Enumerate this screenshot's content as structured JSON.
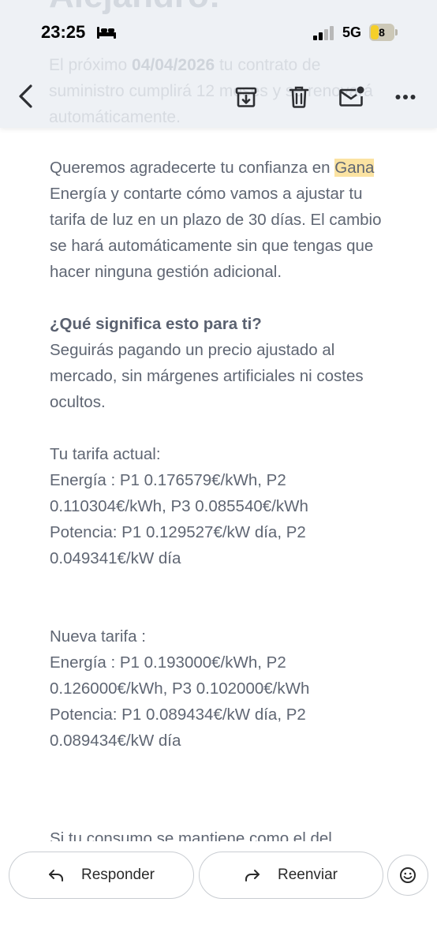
{
  "status_bar": {
    "time": "23:25",
    "network": "5G",
    "battery_level": "8",
    "icons": [
      "bed-icon",
      "signal-icon",
      "battery-icon"
    ],
    "battery_accent": "#f5cf29"
  },
  "faded_background": {
    "heading": "Alejandro!",
    "text_parts": [
      "El próximo ",
      "04/04/2026",
      " tu contrato de suministro cumplirá 12 meses y se renovará automáticamente."
    ]
  },
  "toolbar": {
    "icons": [
      "back-arrow-icon",
      "archive-icon",
      "trash-icon",
      "mail-unread-icon",
      "more-icon"
    ]
  },
  "email": {
    "intro_pre": "Queremos agradecerte tu confianza en ",
    "intro_highlight": "Gana",
    "intro_post": " Energía y contarte cómo vamos a ajustar tu tarifa de luz en un plazo de 30 días. El cambio se hará automáticamente sin que tengas que hacer ninguna gestión adicional.",
    "question": "¿Qué significa esto para ti?",
    "answer": "Seguirás pagando un precio ajustado al mercado, sin márgenes artificiales ni costes ocultos.",
    "current_title": "Tu tarifa actual:",
    "current_energy": "Energía : P1 0.176579€/kWh, P2 0.110304€/kWh, P3 0.085540€/kWh",
    "current_power": "Potencia: P1 0.129527€/kW día, P2 0.049341€/kW día",
    "new_title": "Nueva tarifa :",
    "new_energy": "Energía : P1 0.193000€/kWh, P2 0.126000€/kWh, P3 0.102000€/kWh",
    "new_power": "Potencia: P1 0.089434€/kW día, P2 0.089434€/kW día",
    "cut_line": "Si tu consumo se mantiene como el del"
  },
  "actions": {
    "reply_label": "Responder",
    "forward_label": "Reenviar",
    "icons": [
      "reply-icon",
      "forward-icon",
      "emoji-icon"
    ]
  },
  "colors": {
    "body_text": "#5f6673",
    "highlight": "#fbe3a2",
    "toolbar_bg": "#eef1f5"
  }
}
